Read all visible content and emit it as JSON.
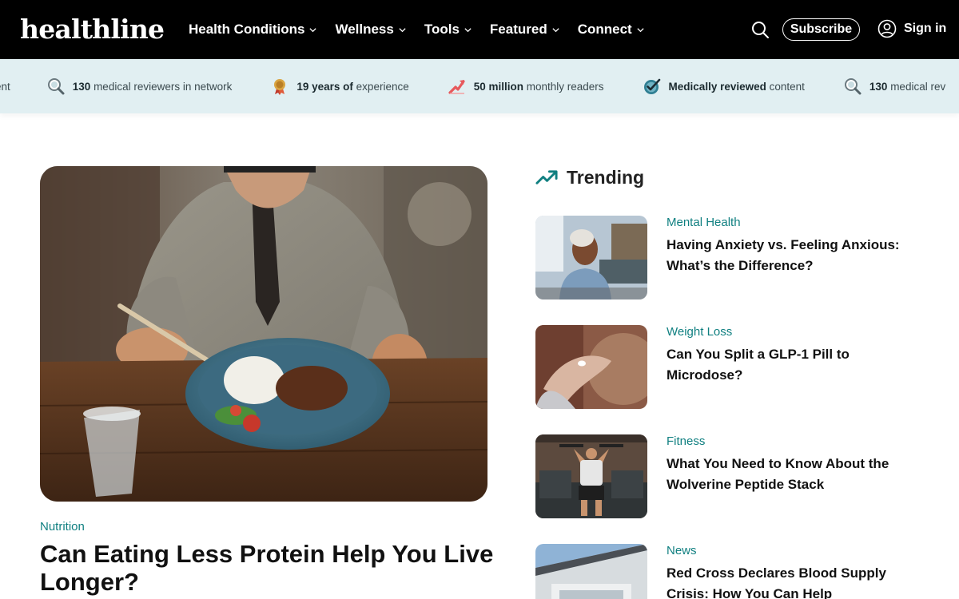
{
  "header": {
    "logo": "healthline",
    "nav": [
      {
        "label": "Health Conditions"
      },
      {
        "label": "Wellness"
      },
      {
        "label": "Tools"
      },
      {
        "label": "Featured"
      },
      {
        "label": "Connect"
      }
    ],
    "search_icon": "search-icon",
    "subscribe_label": "Subscribe",
    "signin_label": "Sign in",
    "colors": {
      "background": "#000000",
      "text": "#ffffff"
    }
  },
  "ticker": {
    "background": "#e1eff2",
    "items": [
      {
        "bold": "",
        "text": "ent",
        "icon": "none"
      },
      {
        "bold": "130",
        "text": " medical reviewers in network",
        "icon": "magnifier-icon"
      },
      {
        "bold": "19 years of",
        "text": " experience",
        "icon": "award-medal-icon"
      },
      {
        "bold": "50 million",
        "text": " monthly readers",
        "icon": "growth-arrow-icon"
      },
      {
        "bold": "Medically reviewed",
        "text": " content",
        "icon": "checkmark-badge-icon"
      },
      {
        "bold": "130",
        "text": " medical rev",
        "icon": "magnifier-icon"
      }
    ]
  },
  "hero": {
    "category": "Nutrition",
    "title": "Can Eating Less Protein Help You Live Longer?",
    "image": "man-eating-rice-bowl-photo"
  },
  "trending": {
    "heading": "Trending",
    "accent": "#0f7f80",
    "items": [
      {
        "category": "Mental Health",
        "title": "Having Anxiety vs. Feeling Anxious: What’s the Difference?",
        "image": "woman-city-street-photo"
      },
      {
        "category": "Weight Loss",
        "title": "Can You Split a GLP-1 Pill to Microdose?",
        "image": "hand-holding-pill-photo"
      },
      {
        "category": "Fitness",
        "title": "What You Need to Know About the Wolverine Peptide Stack",
        "image": "man-lifting-dumbbells-photo"
      },
      {
        "category": "News",
        "title": "Red Cross Declares Blood Supply Crisis: How You Can Help",
        "image": "building-exterior-photo"
      }
    ]
  }
}
